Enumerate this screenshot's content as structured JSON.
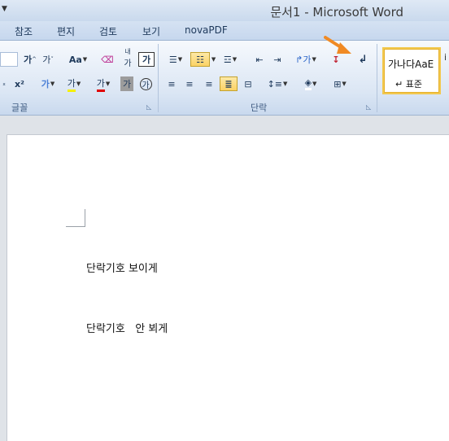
{
  "window": {
    "title": "문서1  -  Microsoft Word"
  },
  "tabs": [
    "참조",
    "편지",
    "검토",
    "보기",
    "novaPDF"
  ],
  "ribbon": {
    "font_group_label": "글꼴",
    "paragraph_group_label": "단락",
    "font_buttons": {
      "grow_font": "가",
      "shrink_font": "가",
      "change_case": "Aa",
      "phonetic": "가",
      "phonetic_top": "내",
      "char_border": "가",
      "superscript": "x²",
      "text_effect": "가",
      "highlight": "가",
      "font_color": "가",
      "char_shading": "가",
      "enclose": "가"
    },
    "styles": {
      "sample": "가나다AaE",
      "name": "↵ 표준"
    }
  },
  "document": {
    "lines": [
      "단락기호 보이게",
      "단락기호   안 뵈게"
    ]
  }
}
